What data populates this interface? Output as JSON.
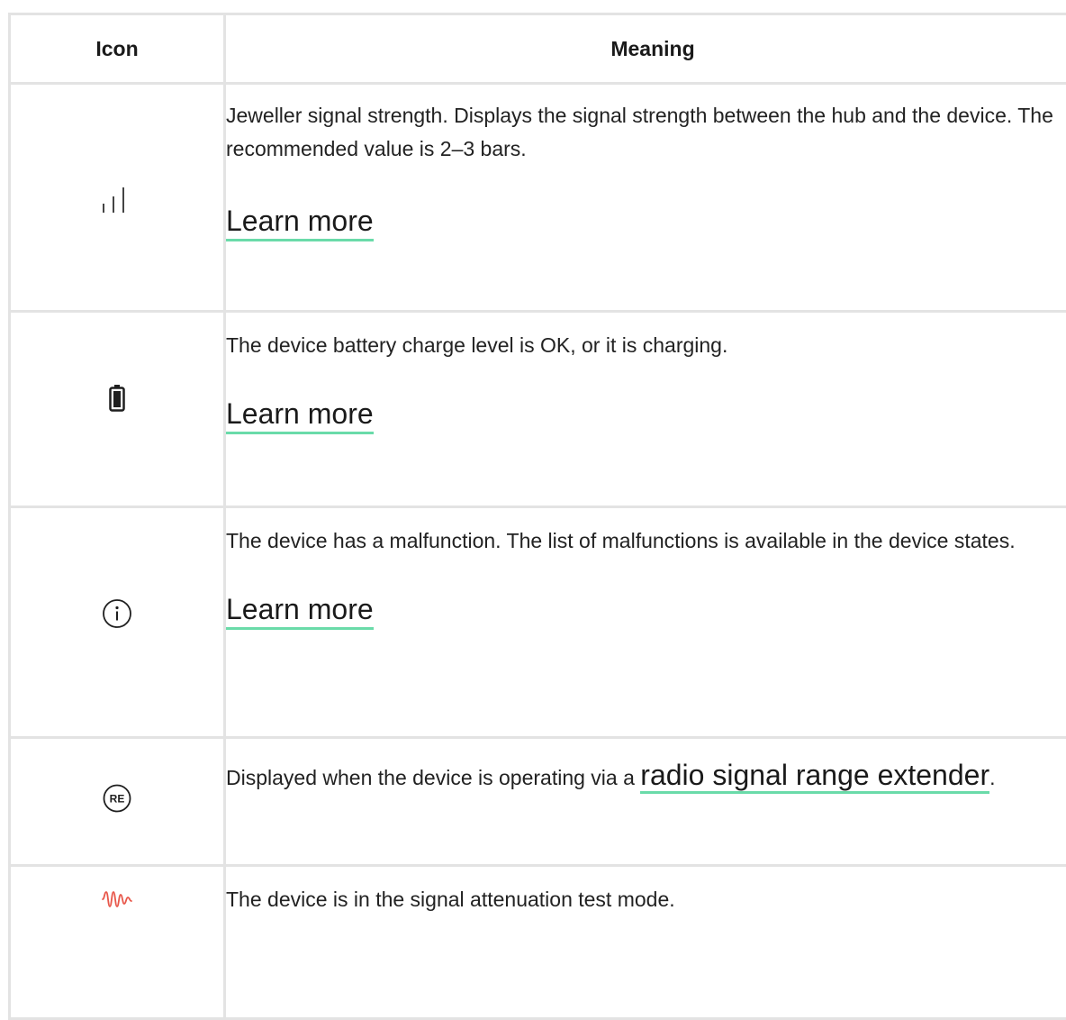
{
  "table": {
    "headers": {
      "icon": "Icon",
      "meaning": "Meaning"
    },
    "rows": [
      {
        "icon": "signal-strength-icon",
        "description": "Jeweller signal strength. Displays the signal strength between the hub and the device. The recommended value is 2–3 bars.",
        "link_label": "Learn more"
      },
      {
        "icon": "battery-icon",
        "description": "The device battery charge level is OK, or it is charging.",
        "link_label": "Learn more"
      },
      {
        "icon": "info-icon",
        "description": "The device has a malfunction. The list of malfunctions is available in the device states.",
        "link_label": "Learn more"
      },
      {
        "icon": "range-extender-icon",
        "icon_text": "RE",
        "description_prefix": "Displayed when the device is operating via a ",
        "link_label": "radio signal range extender",
        "description_suffix": "."
      },
      {
        "icon": "attenuation-test-icon",
        "description": "The device is in the signal attenuation test mode."
      }
    ]
  },
  "colors": {
    "border": "#e3e3e3",
    "link_underline": "#6adba9",
    "attenuation_icon": "#e8574a"
  }
}
